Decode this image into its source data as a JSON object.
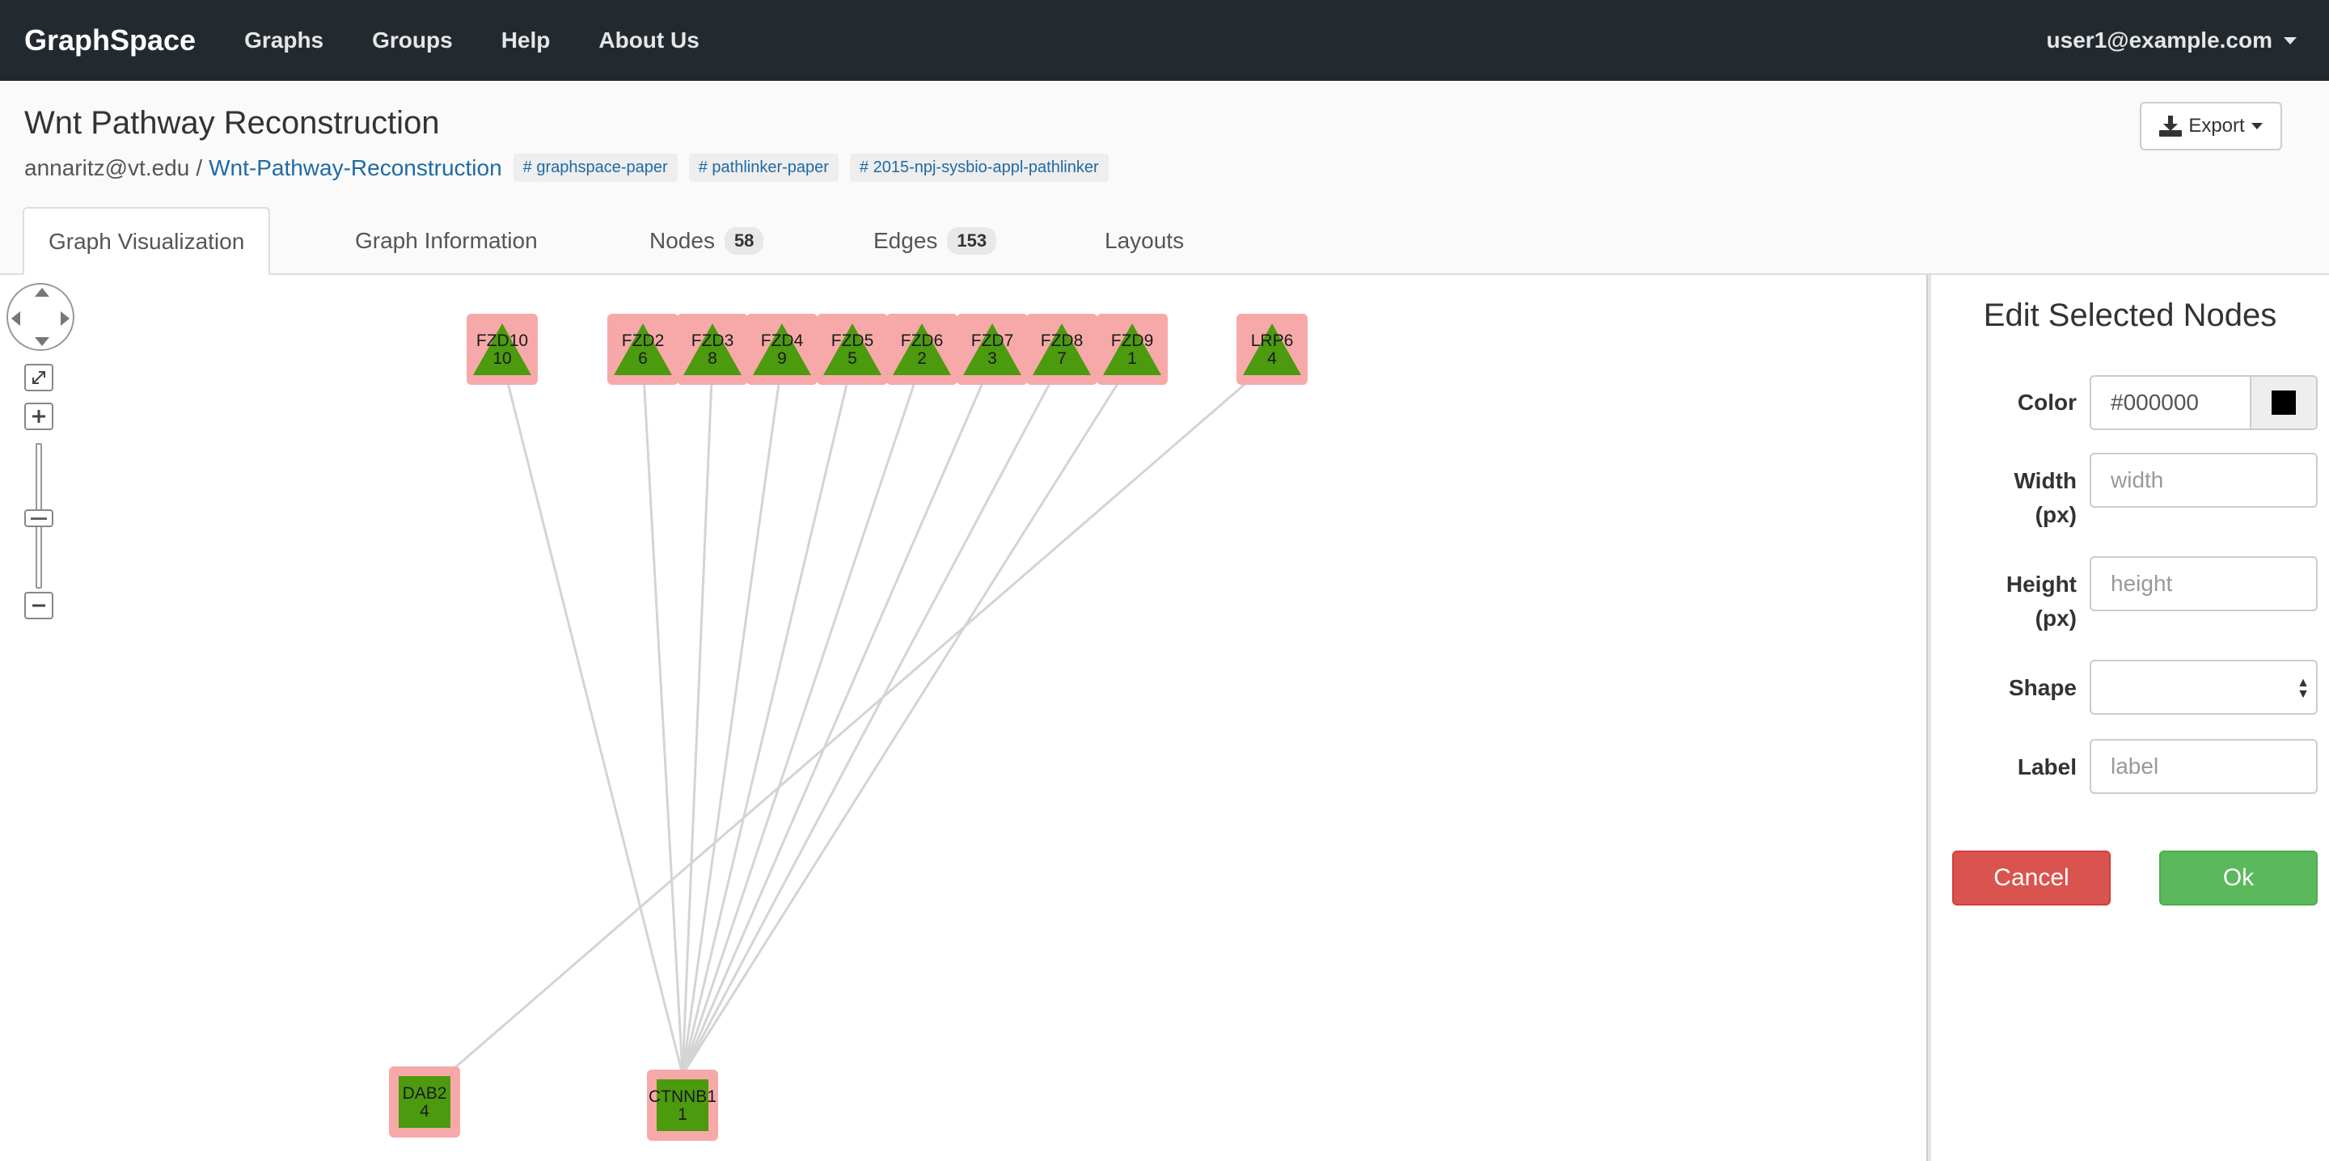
{
  "navbar": {
    "brand": "GraphSpace",
    "links": [
      "Graphs",
      "Groups",
      "Help",
      "About Us"
    ],
    "user": "user1@example.com"
  },
  "header": {
    "title": "Wnt Pathway Reconstruction",
    "owner": "annaritz@vt.edu",
    "separator": "/",
    "graph_name": "Wnt-Pathway-Reconstruction",
    "tags": [
      "graphspace-paper",
      "pathlinker-paper",
      "2015-npj-sysbio-appl-pathlinker"
    ],
    "export_label": "Export"
  },
  "tabs": [
    {
      "label": "Graph Visualization",
      "active": true
    },
    {
      "label": "Graph Information"
    },
    {
      "label": "Nodes",
      "count": "58"
    },
    {
      "label": "Edges",
      "count": "153"
    },
    {
      "label": "Layouts"
    }
  ],
  "graph": {
    "node_fill": "#4c9a0e",
    "selection_color": "#f7a9a9",
    "edge_color": "#d4d4d4",
    "nodes": [
      {
        "id": "FZD10",
        "rank": "10",
        "shape": "triangle"
      },
      {
        "id": "FZD2",
        "rank": "6",
        "shape": "triangle"
      },
      {
        "id": "FZD3",
        "rank": "8",
        "shape": "triangle"
      },
      {
        "id": "FZD4",
        "rank": "9",
        "shape": "triangle"
      },
      {
        "id": "FZD5",
        "rank": "5",
        "shape": "triangle"
      },
      {
        "id": "FZD6",
        "rank": "2",
        "shape": "triangle"
      },
      {
        "id": "FZD7",
        "rank": "3",
        "shape": "triangle"
      },
      {
        "id": "FZD8",
        "rank": "7",
        "shape": "triangle"
      },
      {
        "id": "FZD9",
        "rank": "1",
        "shape": "triangle"
      },
      {
        "id": "LRP6",
        "rank": "4",
        "shape": "triangle"
      },
      {
        "id": "DAB2",
        "rank": "4",
        "shape": "square"
      },
      {
        "id": "CTNNB1",
        "rank": "1",
        "shape": "square"
      }
    ],
    "edges": [
      [
        "FZD10",
        "CTNNB1"
      ],
      [
        "FZD2",
        "CTNNB1"
      ],
      [
        "FZD3",
        "CTNNB1"
      ],
      [
        "FZD4",
        "CTNNB1"
      ],
      [
        "FZD5",
        "CTNNB1"
      ],
      [
        "FZD6",
        "CTNNB1"
      ],
      [
        "FZD7",
        "CTNNB1"
      ],
      [
        "FZD8",
        "CTNNB1"
      ],
      [
        "FZD9",
        "CTNNB1"
      ],
      [
        "LRP6",
        "DAB2"
      ]
    ]
  },
  "edit_panel": {
    "title": "Edit Selected Nodes",
    "color_label": "Color",
    "color_value": "#000000",
    "width_label_1": "Width",
    "width_label_2": "(px)",
    "width_placeholder": "width",
    "height_label_1": "Height",
    "height_label_2": "(px)",
    "height_placeholder": "height",
    "shape_label": "Shape",
    "label_label": "Label",
    "label_placeholder": "label",
    "cancel_label": "Cancel",
    "ok_label": "Ok"
  }
}
